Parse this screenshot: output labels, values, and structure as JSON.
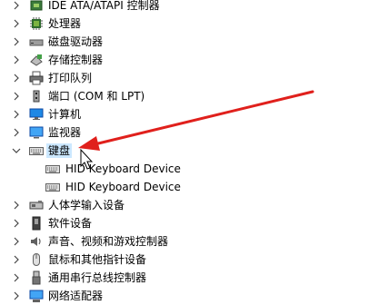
{
  "device_tree": {
    "items": [
      {
        "label": "IDE ATA/ATAPI 控制器",
        "icon": "ide-controller-icon",
        "expanded": false
      },
      {
        "label": "处理器",
        "icon": "processor-icon",
        "expanded": false
      },
      {
        "label": "磁盘驱动器",
        "icon": "disk-drive-icon",
        "expanded": false
      },
      {
        "label": "存储控制器",
        "icon": "storage-controller-icon",
        "expanded": false
      },
      {
        "label": "打印队列",
        "icon": "printer-icon",
        "expanded": false
      },
      {
        "label": "端口 (COM 和 LPT)",
        "icon": "port-icon",
        "expanded": false
      },
      {
        "label": "计算机",
        "icon": "computer-icon",
        "expanded": false
      },
      {
        "label": "监视器",
        "icon": "monitor-icon",
        "expanded": false
      },
      {
        "label": "键盘",
        "icon": "keyboard-icon",
        "expanded": true,
        "selected": true
      },
      {
        "label": "HID Keyboard Device",
        "icon": "keyboard-device-icon",
        "child": true
      },
      {
        "label": "HID Keyboard Device",
        "icon": "keyboard-device-icon",
        "child": true
      },
      {
        "label": "人体学输入设备",
        "icon": "hid-icon",
        "expanded": false
      },
      {
        "label": "软件设备",
        "icon": "software-device-icon",
        "expanded": false
      },
      {
        "label": "声音、视频和游戏控制器",
        "icon": "sound-icon",
        "expanded": false
      },
      {
        "label": "鼠标和其他指针设备",
        "icon": "mouse-icon",
        "expanded": false
      },
      {
        "label": "通用串行总线控制器",
        "icon": "usb-icon",
        "expanded": false
      },
      {
        "label": "网络适配器",
        "icon": "network-adapter-icon",
        "expanded": false
      }
    ]
  },
  "colors": {
    "selection": "#cce8ff",
    "annotation_arrow": "#e0201c",
    "monitor_blue": "#1e88e5"
  }
}
